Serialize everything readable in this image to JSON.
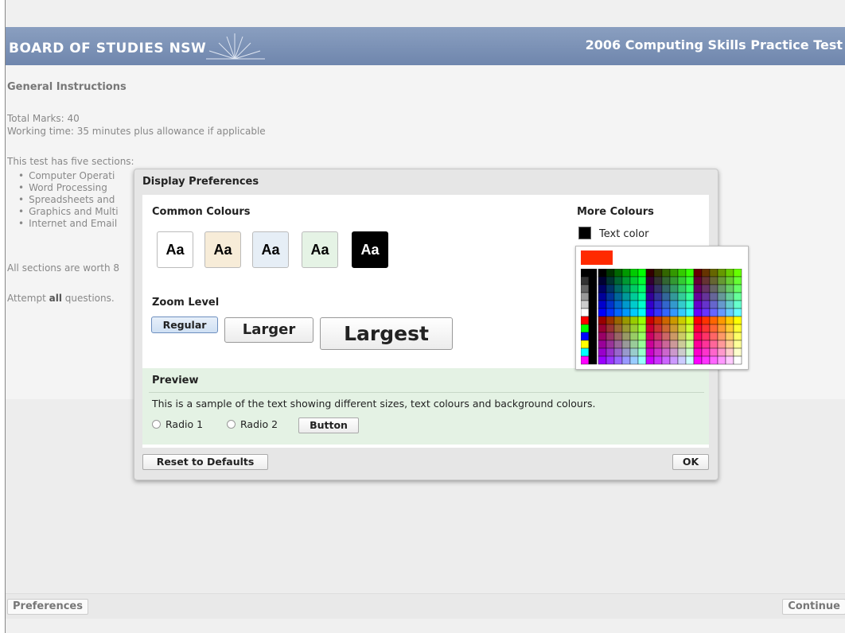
{
  "header": {
    "logo_text": "BOARD OF STUDIES NSW",
    "title": "2006 Computing Skills Practice Test"
  },
  "instructions": {
    "title": "General Instructions",
    "total_marks": "Total Marks: 40",
    "working_time": "Working time: 35 minutes plus allowance if applicable",
    "sections_intro": "This test has five sections:",
    "sections": [
      "Computer Operati",
      "Word Processing",
      "Spreadsheets and",
      "Graphics and Multi",
      "Internet and Email"
    ],
    "worth": "All sections are worth 8",
    "attempt_prefix": "Attempt ",
    "attempt_bold": "all",
    "attempt_suffix": " questions."
  },
  "modal": {
    "title": "Display Preferences",
    "common_colours_label": "Common Colours",
    "swatches": [
      {
        "label": "Aa",
        "bg": "#ffffff",
        "fg": "#000000"
      },
      {
        "label": "Aa",
        "bg": "#f7ecd8",
        "fg": "#000000"
      },
      {
        "label": "Aa",
        "bg": "#e6eef6",
        "fg": "#000000"
      },
      {
        "label": "Aa",
        "bg": "#e5f3e5",
        "fg": "#000000"
      },
      {
        "label": "Aa",
        "bg": "#000000",
        "fg": "#ffffff"
      }
    ],
    "more_colours_label": "More Colours",
    "text_color_label": "Text color",
    "text_color_value": "#000000",
    "picker_current_color": "#ff2a00",
    "zoom_label": "Zoom Level",
    "zoom_regular": "Regular",
    "zoom_larger": "Larger",
    "zoom_largest": "Largest",
    "preview_title": "Preview",
    "preview_text": "This is a sample of the text showing different sizes, text colours and background colours.",
    "radio1": "Radio 1",
    "radio2": "Radio 2",
    "button_label": "Button",
    "reset_label": "Reset to Defaults",
    "ok_label": "OK"
  },
  "footer": {
    "preferences_label": "Preferences",
    "continue_label": "Continue"
  }
}
